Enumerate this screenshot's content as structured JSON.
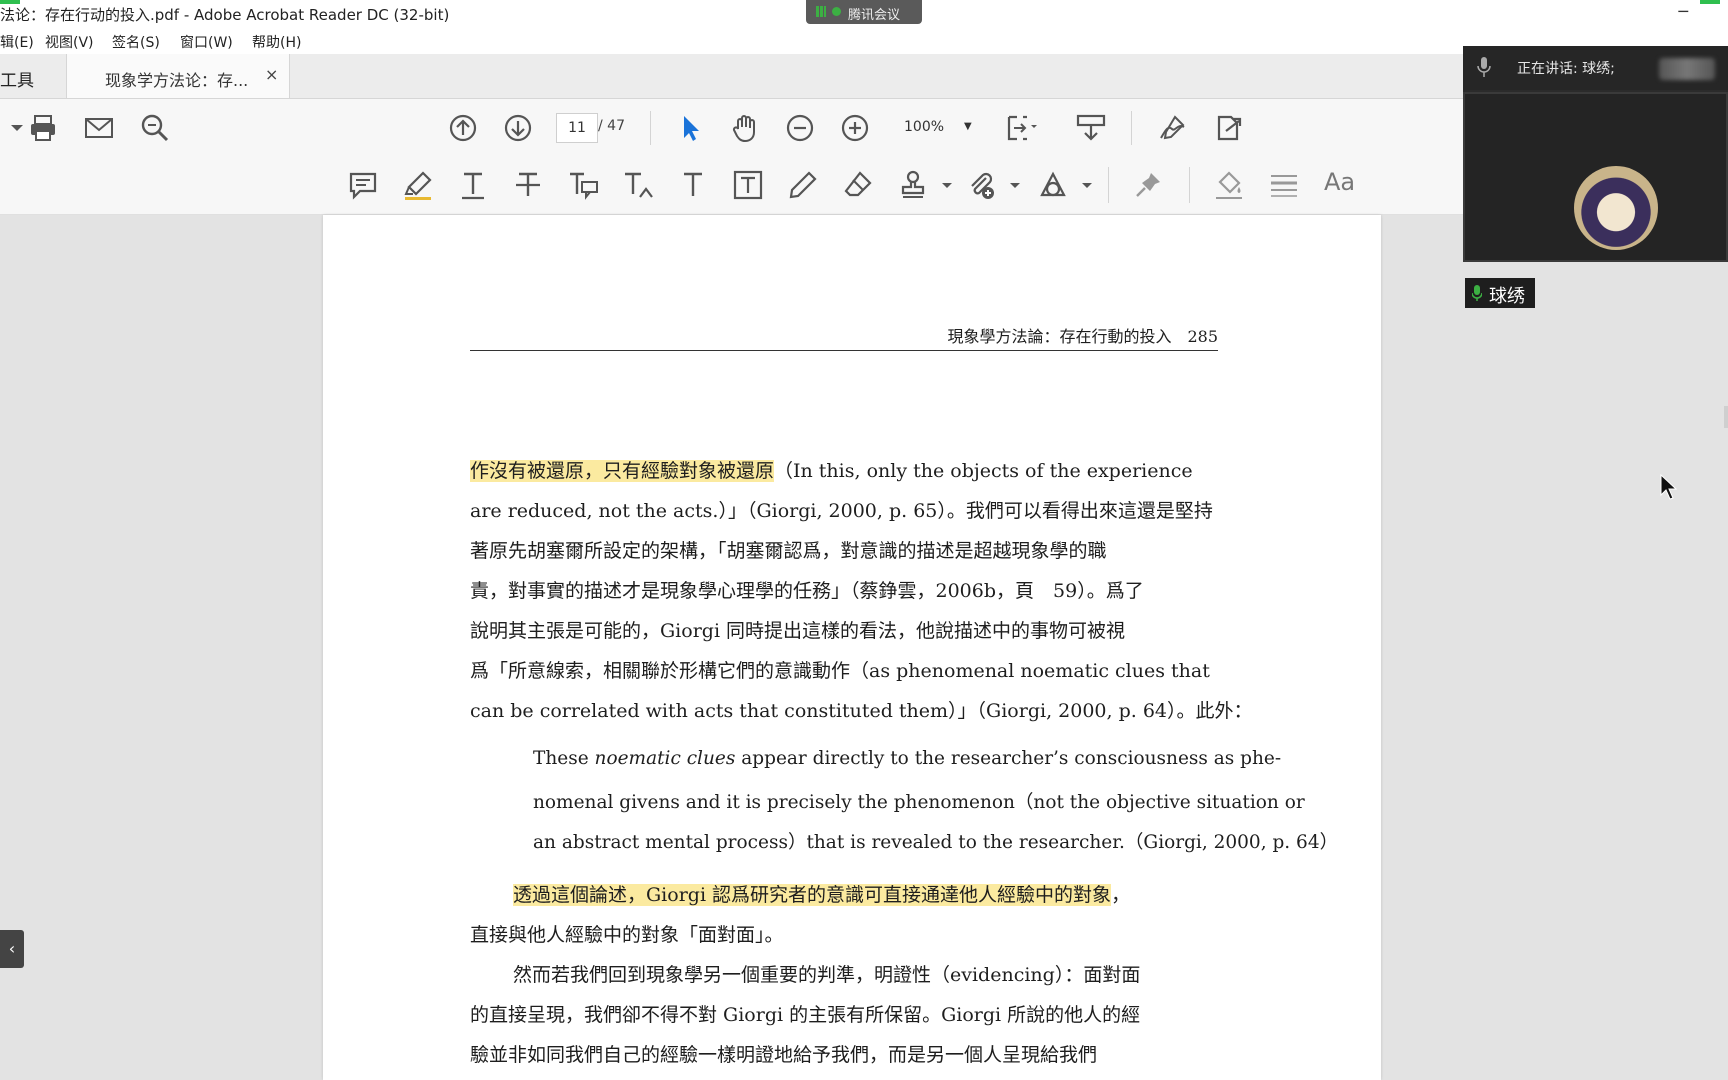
{
  "window": {
    "title": "法论：存在行动的投入.pdf - Adobe Acrobat Reader DC (32-bit)",
    "minimize_glyph": "─"
  },
  "meeting_tag": {
    "label": "腾讯会议"
  },
  "menu": {
    "edit": "辑(E)",
    "view": "视图(V)",
    "sign": "签名(S)",
    "window": "窗口(W)",
    "help": "帮助(H)"
  },
  "tabs": {
    "tools": "工具",
    "document": "现象学方法论：存...",
    "close_glyph": "×"
  },
  "toolbar": {
    "current_page": "11",
    "total_pages": "/ 47",
    "zoom": "100%",
    "text_size_glyph": "Aa"
  },
  "icons": {
    "print": "print-icon",
    "email": "email-icon",
    "search": "search-icon",
    "prev_page": "arrow-up-circle-icon",
    "next_page": "arrow-down-circle-icon",
    "select": "pointer-icon",
    "hand": "hand-icon",
    "zoom_out": "zoom-out-icon",
    "zoom_in": "zoom-in-icon",
    "fit": "fit-page-icon",
    "scroll": "scroll-mode-icon",
    "sign": "sign-icon",
    "share": "share-icon",
    "comment": "comment-icon",
    "highlight": "highlighter-icon",
    "underline": "underline-icon",
    "strikethrough": "strikethrough-icon",
    "replace": "replace-text-icon",
    "insert": "insert-text-icon",
    "text": "text-icon",
    "textbox": "textbox-icon",
    "pencil": "pencil-icon",
    "eraser": "eraser-icon",
    "stamp": "stamp-icon",
    "attach": "attach-icon",
    "shapes": "shapes-icon",
    "pin": "pin-icon",
    "fill": "fill-color-icon",
    "lines": "line-style-icon"
  },
  "document": {
    "running_header": "現象學方法論：存在行動的投入　285",
    "lines": [
      {
        "hl": "作沒有被還原，只有經驗對象被還原",
        "rest": "（In this, only the objects of the experience"
      },
      {
        "text": "are reduced, not the acts.）」（Giorgi, 2000, p. 65）。我們可以看得出來這還是堅持"
      },
      {
        "text": "著原先胡塞爾所設定的架構，「胡塞爾認爲，對意識的描述是超越現象學的職"
      },
      {
        "text": "責，對事實的描述才是現象學心理學的任務」（蔡錚雲，2006b，頁　59）。爲了"
      },
      {
        "text": "說明其主張是可能的，Giorgi 同時提出這樣的看法，他說描述中的事物可被視"
      },
      {
        "text": "爲「所意線索，相關聯於形構它們的意識動作（as phenomenal noematic clues that"
      },
      {
        "text": "can be correlated with acts that constituted them）」（Giorgi, 2000, p. 64）。此外："
      }
    ],
    "quote": [
      "These noematic clues appear directly to the researcher’s consciousness as phe-",
      "nomenal givens and it is precisely the phenomenon（not the objective situation or",
      "an abstract mental process）that is revealed to the researcher.（Giorgi, 2000, p. 64）"
    ],
    "quote_italic": "noematic clues",
    "para2_hl": "透過這個論述，Giorgi 認爲研究者的意識可直接通達他人經驗中的對象",
    "para2_rest": "，",
    "para2_line2": "直接與他人經驗中的對象「面對面」。",
    "para3": [
      "然而若我們回到現象學另一個重要的判準，明證性（evidencing）：面對面",
      "的直接呈現，我們卻不得不對 Giorgi 的主張有所保留。Giorgi 所說的他人的經",
      "驗並非如同我們自己的經驗一樣明證地給予我們，而是另一個人呈現給我們"
    ]
  },
  "meeting_panel": {
    "speaking": "正在讲话: 球绣;",
    "name": "球绣"
  },
  "side_tab_glyph": "‹"
}
